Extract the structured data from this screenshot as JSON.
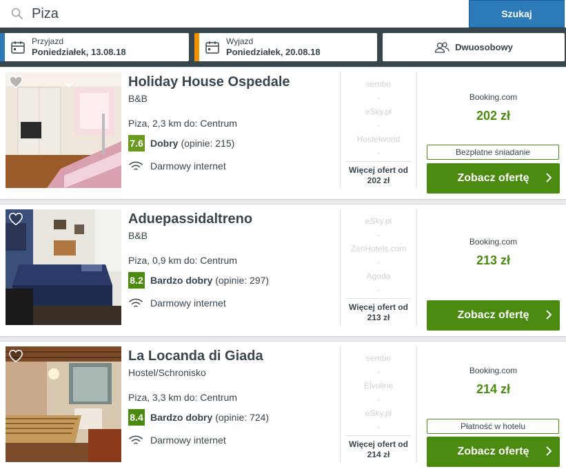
{
  "search": {
    "value": "Piza",
    "button_label": "Szukaj"
  },
  "filters": {
    "checkin": {
      "label": "Przyjazd",
      "value": "Poniedziałek, 13.08.18",
      "accent": "#2c7ab7"
    },
    "checkout": {
      "label": "Wyjazd",
      "value": "Poniedziałek, 20.08.18",
      "accent": "#f39200"
    },
    "guests": {
      "label": "Dwuosobowy",
      "icon": "guests-icon"
    }
  },
  "colors": {
    "rating": "#4a8a10",
    "cta": "#4a8a10",
    "search_button": "#2c7ab7",
    "toolbar": "#37454d"
  },
  "hotels": [
    {
      "name": "Holiday House Ospedale",
      "type": "B&B",
      "location": "Piza, 2,3 km do: Centrum",
      "score": "7.6",
      "score_color": "#6a9a20",
      "rating_word": "Dobry",
      "reviews": "(opinie: 215)",
      "amenity": "Darmowy internet",
      "other_sites": [
        "sembo",
        "-",
        "eSky.pl",
        "-",
        "Hostelworld",
        "-"
      ],
      "more_offers_line1": "Więcej ofert od",
      "more_offers_line2": "202 zł",
      "provider": "Booking.com",
      "price": "202 zł",
      "perk": "Bezpłatne śniadanie",
      "cta": "Zobacz ofertę"
    },
    {
      "name": "Aduepassidaltreno",
      "type": "B&B",
      "location": "Piza, 0,9 km do: Centrum",
      "score": "8.2",
      "score_color": "#4a8a10",
      "rating_word": "Bardzo dobry",
      "reviews": "(opinie: 297)",
      "amenity": "Darmowy internet",
      "other_sites": [
        "eSky.pl",
        "-",
        "ZenHotels.com",
        "-",
        "Agoda",
        "-"
      ],
      "more_offers_line1": "Więcej ofert od",
      "more_offers_line2": "213 zł",
      "provider": "Booking.com",
      "price": "213 zł",
      "perk": "",
      "cta": "Zobacz ofertę"
    },
    {
      "name": "La Locanda di Giada",
      "type": "Hostel/Schronisko",
      "location": "Piza, 3,3 km do: Centrum",
      "score": "8.4",
      "score_color": "#4a8a10",
      "rating_word": "Bardzo dobry",
      "reviews": "(opinie: 724)",
      "amenity": "Darmowy internet",
      "other_sites": [
        "sembo",
        "-",
        "Elvoline",
        "-",
        "eSky.pl",
        "-"
      ],
      "more_offers_line1": "Więcej ofert od",
      "more_offers_line2": "214 zł",
      "provider": "Booking.com",
      "price": "214 zł",
      "perk": "Płatność w hotelu",
      "cta": "Zobacz ofertę"
    }
  ]
}
